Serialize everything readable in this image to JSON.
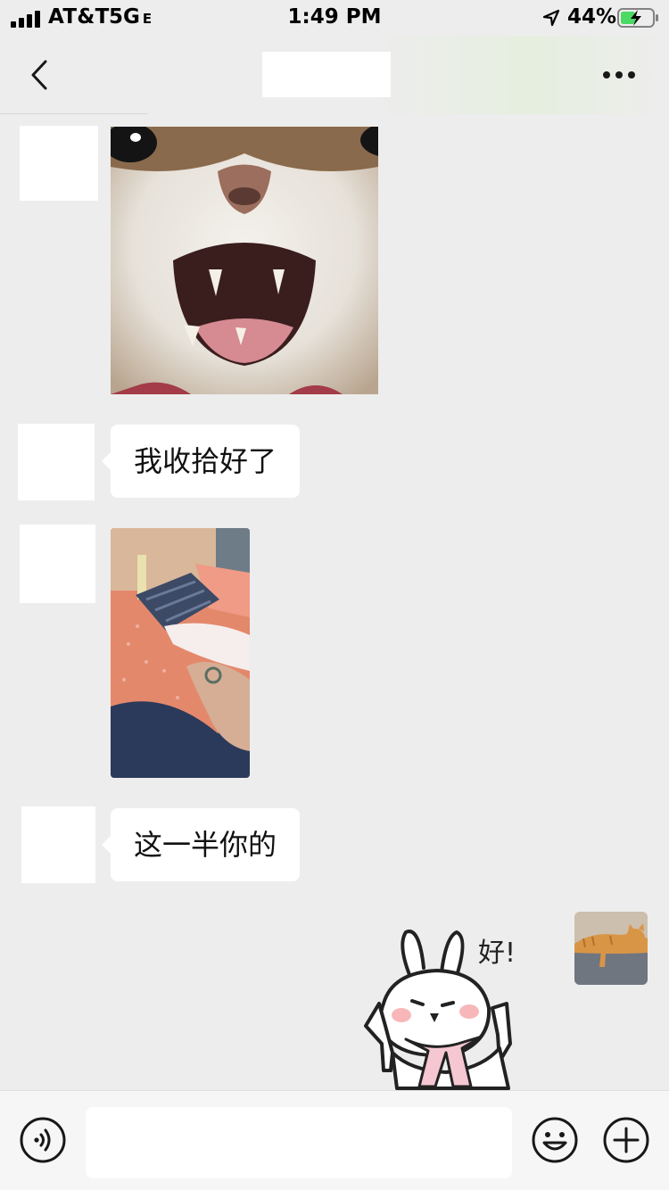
{
  "status_bar": {
    "carrier": "AT&T",
    "network": "5G",
    "network_suffix": "E",
    "time": "1:49 PM",
    "battery": "44%",
    "battery_level": 0.44
  },
  "nav": {
    "back_icon": "chevron-left-icon",
    "more_icon": "more-dots-icon"
  },
  "messages": [
    {
      "type": "image",
      "content": "cat-open-mouth-photo"
    },
    {
      "type": "text",
      "text": "我收拾好了"
    },
    {
      "type": "image",
      "content": "bed-photo"
    },
    {
      "type": "text",
      "text": "这一半你的"
    },
    {
      "type": "sticker",
      "content": "bunny-sticker",
      "text": "好!"
    }
  ],
  "input_bar": {
    "voice_icon": "voice-icon",
    "emoji_icon": "emoji-icon",
    "plus_icon": "plus-icon",
    "placeholder": ""
  },
  "colors": {
    "background": "#ededed",
    "bubble": "#ffffff",
    "icon": "#181818"
  }
}
